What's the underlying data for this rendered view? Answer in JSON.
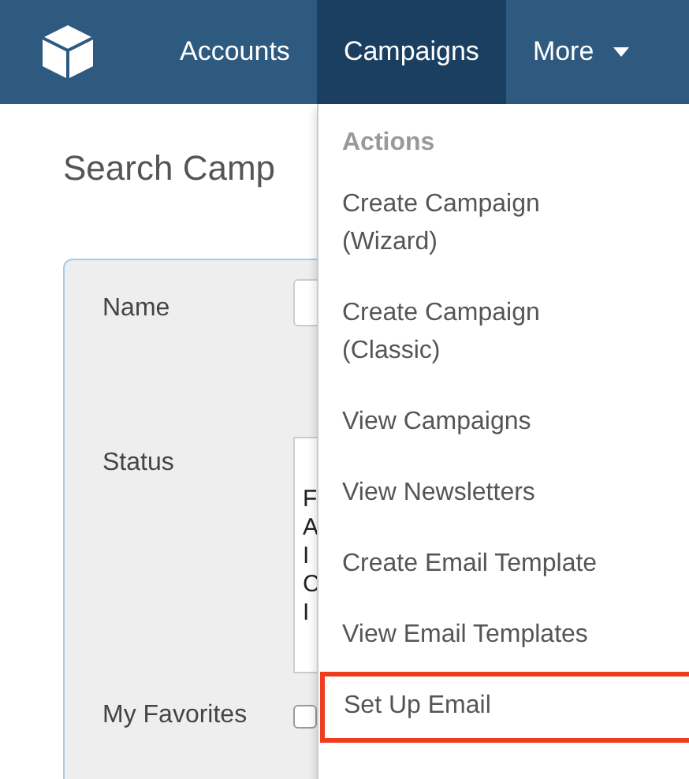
{
  "nav": {
    "items": [
      {
        "label": "Accounts",
        "selected": false
      },
      {
        "label": "Campaigns",
        "selected": true
      },
      {
        "label": "More",
        "selected": false,
        "kind": "dropdown"
      }
    ]
  },
  "page": {
    "title": "Search Camp",
    "fields": [
      {
        "kind": "text",
        "label": "Name"
      },
      {
        "kind": "list",
        "label": "Status",
        "options": [
          "F",
          "A",
          "I",
          "C",
          "I"
        ]
      },
      {
        "kind": "checkbox",
        "label": "My Favorites",
        "checked": false
      }
    ]
  },
  "menu": {
    "header": "Actions",
    "items": [
      {
        "label": "Create Campaign (Wizard)",
        "highlighted": false
      },
      {
        "label": "Create Campaign (Classic)",
        "highlighted": false
      },
      {
        "label": "View Campaigns",
        "highlighted": false
      },
      {
        "label": "View Newsletters",
        "highlighted": false
      },
      {
        "label": "Create Email Template",
        "highlighted": false
      },
      {
        "label": "View Email Templates",
        "highlighted": false
      },
      {
        "label": "Set Up Email",
        "highlighted": true
      }
    ]
  }
}
